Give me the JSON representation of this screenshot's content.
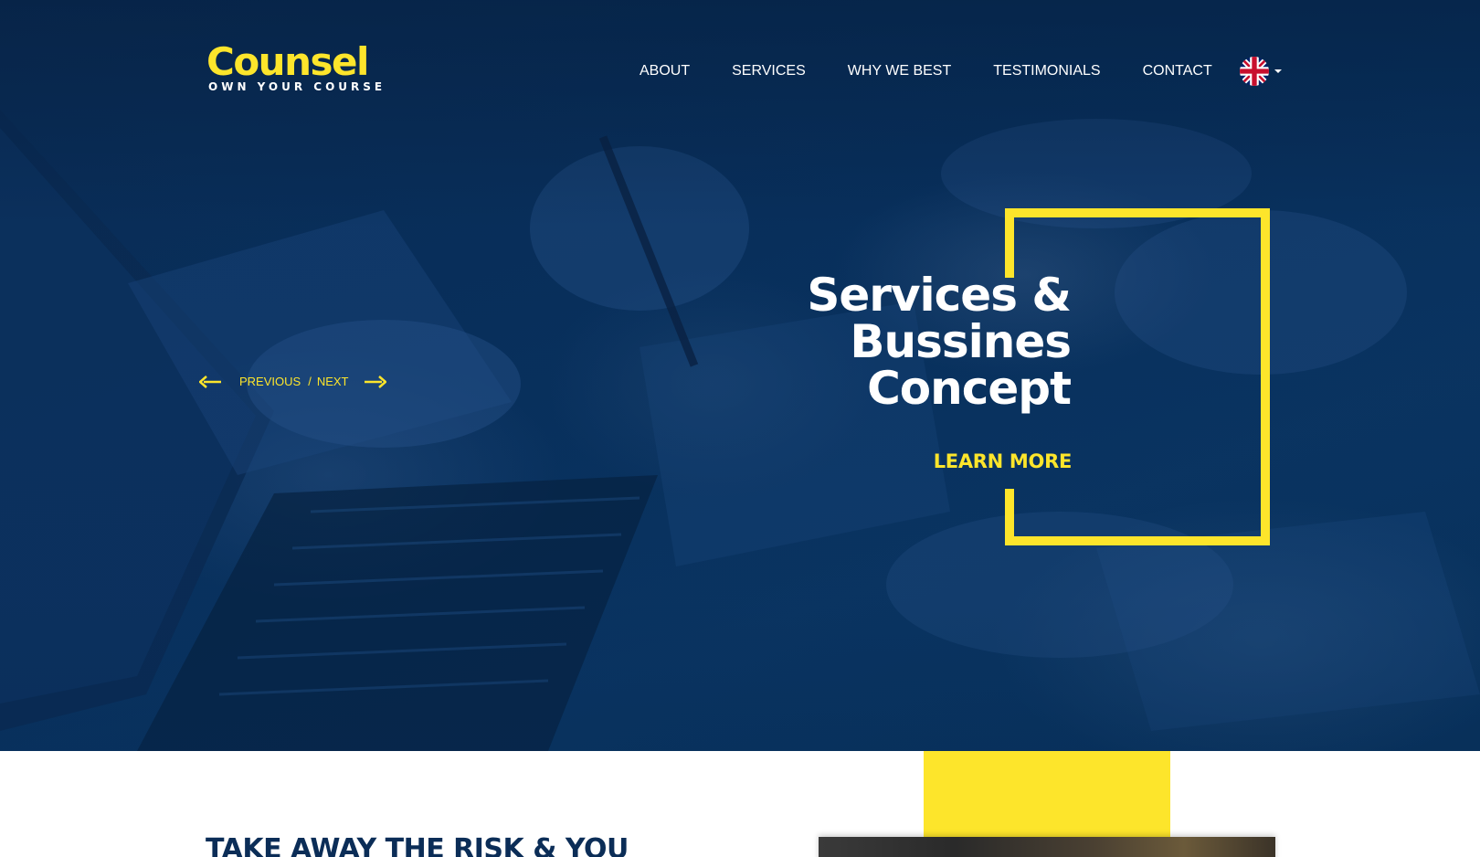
{
  "brand": {
    "name": "Counsel",
    "tagline": "OWN YOUR COURSE"
  },
  "nav": {
    "items": [
      {
        "label": "ABOUT"
      },
      {
        "label": "SERVICES"
      },
      {
        "label": "WHY WE BEST"
      },
      {
        "label": "TESTIMONIALS"
      },
      {
        "label": "CONTACT"
      }
    ],
    "language_icon": "uk-flag-icon"
  },
  "slider": {
    "previous_label": "PREVIOUS",
    "separator": "/",
    "next_label": "NEXT"
  },
  "hero": {
    "headline_lines": [
      "Services &",
      "Bussines",
      "Concept"
    ],
    "cta_label": "LEARN MORE"
  },
  "section": {
    "heading": "TAKE AWAY THE RISK & YOU"
  },
  "colors": {
    "accent": "#fde52b",
    "hero_bg": "#08305d",
    "heading": "#0b2d57"
  }
}
